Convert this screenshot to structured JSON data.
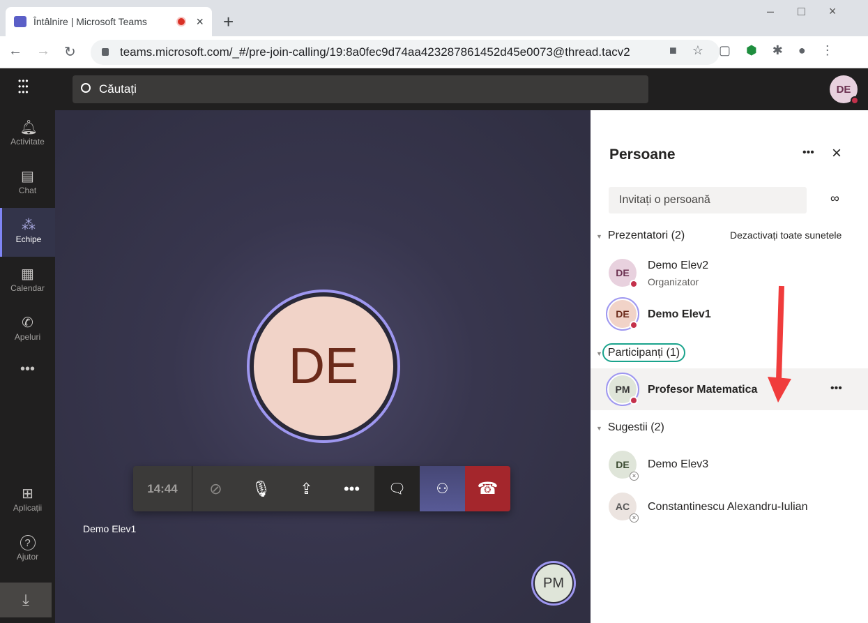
{
  "browser": {
    "tab_title": "Întâlnire | Microsoft Teams",
    "url": "teams.microsoft.com/_#/pre-join-calling/19:8a0fec9d74aa423287861452d45e0073@thread.tacv2"
  },
  "header": {
    "search_placeholder": "Căutați",
    "user_initials": "DE"
  },
  "rail": {
    "items": [
      {
        "label": "Activitate",
        "icon": "bell-icon"
      },
      {
        "label": "Chat",
        "icon": "chat-icon"
      },
      {
        "label": "Echipe",
        "icon": "teams-icon",
        "selected": true
      },
      {
        "label": "Calendar",
        "icon": "calendar-icon"
      },
      {
        "label": "Apeluri",
        "icon": "phone-icon"
      },
      {
        "label": "Aplicații",
        "icon": "apps-icon"
      },
      {
        "label": "Ajutor",
        "icon": "help-icon"
      }
    ]
  },
  "stage": {
    "main_initials": "DE",
    "self_name": "Demo Elev1",
    "self_pip_initials": "PM"
  },
  "controls": {
    "timer": "14:44"
  },
  "panel": {
    "title": "Persoane",
    "invite_placeholder": "Invitați o persoană",
    "mute_all": "Dezactivați toate sunetele",
    "presenters": {
      "label": "Prezentatori",
      "count": "(2)",
      "people": [
        {
          "initials": "DE",
          "name": "Demo Elev2",
          "role": "Organizator"
        },
        {
          "initials": "DE",
          "name": "Demo Elev1"
        }
      ]
    },
    "participants": {
      "label": "Participanți",
      "count": "(1)",
      "people": [
        {
          "initials": "PM",
          "name": "Profesor Matematica"
        }
      ]
    },
    "suggestions": {
      "label": "Sugestii",
      "count": "(2)",
      "people": [
        {
          "initials": "DE",
          "name": "Demo Elev3"
        },
        {
          "initials": "AC",
          "name": "Constantinescu Alexandru-Iulian"
        }
      ]
    }
  },
  "colors": {
    "accent": "#9e97f0",
    "hangup": "#a4262c",
    "status_busy": "#c4314b",
    "annotation_arrow": "#f03c3c",
    "highlight_ring": "#1aa38c"
  }
}
